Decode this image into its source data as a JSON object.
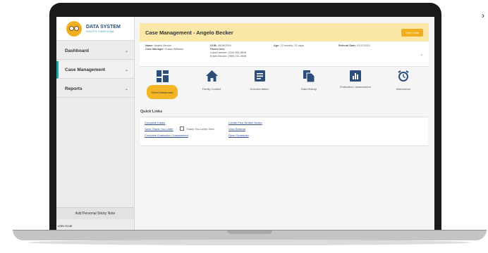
{
  "app": {
    "logo_title": "DATA SYSTEM",
    "logo_subtitle": "SOUTH CAROLINA"
  },
  "sidebar": {
    "items": [
      {
        "label": "Dashboard"
      },
      {
        "label": "Case Management"
      },
      {
        "label": "Reports"
      }
    ],
    "sticky_note_label": "Add Personal Sticky Note",
    "environment": "vdev-local"
  },
  "header": {
    "title": "Case Management - Angelo Becker",
    "help_label": "Help Links"
  },
  "info": {
    "name_label": "Name:",
    "name": "Angelo Becker",
    "case_manager_label": "Case Manager:",
    "case_manager": "Susan Williams",
    "dob_label": "DOB:",
    "dob": "05/18/2019",
    "parent_info_label": "Parent Info:",
    "parent1": "Luisa Hanson: (333) 960-8845",
    "parent2": "Edwin Becker: (989) 231-9538",
    "age_label": "Age:",
    "age": "22 months, 21 days",
    "referral_label": "Referral Date:",
    "referral_date": "01/17/2021"
  },
  "tiles": [
    {
      "label": "Client Dashboard",
      "icon": "dashboard-icon"
    },
    {
      "label": "Family Contact",
      "icon": "home-icon"
    },
    {
      "label": "Documentation",
      "icon": "document-icon"
    },
    {
      "label": "Data History",
      "icon": "files-icon"
    },
    {
      "label": "Evaluation / Assessment",
      "icon": "bar-chart-icon"
    },
    {
      "label": "Attendance",
      "icon": "alarm-clock-icon"
    }
  ],
  "quick_links": {
    "title": "Quick Links",
    "complete_intake": "Complete Intake",
    "send_thank_you": "Send Thank You Letter",
    "thank_you_sent_label": "Thank You Letter Sent",
    "complete_evaluation": "Complete Evaluation / Assessment",
    "create_prior_written_notice": "Create Prior Written Notice",
    "view_referral": "View Referral",
    "open_scheduler": "Open Scheduler"
  },
  "colors": {
    "accent_yellow": "#f3b426",
    "header_bg": "#fbe7a6",
    "brand_blue": "#2b4f7a",
    "active_teal": "#2aa3a3"
  }
}
